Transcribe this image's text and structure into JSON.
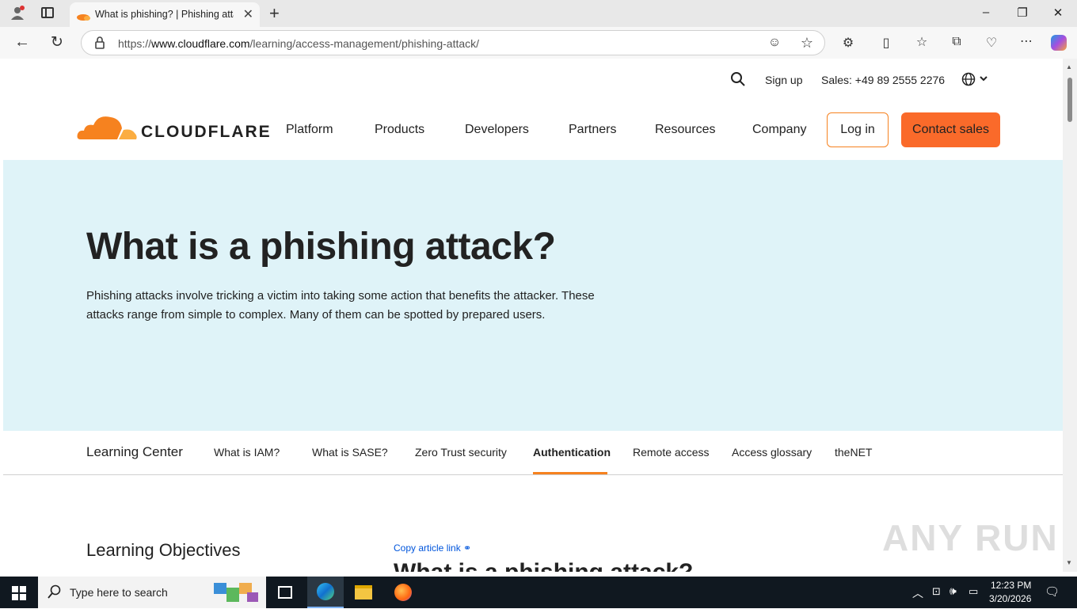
{
  "browser": {
    "tab_title": "What is phishing? | Phishing attac",
    "url_prefix": "https://",
    "url_host": "www.cloudflare.com",
    "url_path": "/learning/access-management/phishing-attack/"
  },
  "utility_nav": {
    "sign_up": "Sign up",
    "sales": "Sales: +49 89 2555 2276"
  },
  "brand": {
    "logo_text": "CLOUDFLARE",
    "orange": "#f6821f",
    "light_orange": "#fbad41"
  },
  "main_nav": {
    "items": [
      "Platform",
      "Products",
      "Developers",
      "Partners",
      "Resources",
      "Company"
    ],
    "login": "Log in",
    "contact": "Contact sales"
  },
  "hero": {
    "title": "What is a phishing attack?",
    "description": "Phishing attacks involve tricking a victim into taking some action that benefits the attacker. These attacks range from simple to complex. Many of them can be spotted by prepared users."
  },
  "sub_nav": {
    "home": "Learning Center",
    "items": [
      "What is IAM?",
      "What is SASE?",
      "Zero Trust security",
      "Authentication",
      "Remote access",
      "Access glossary",
      "theNET"
    ],
    "active": "Authentication"
  },
  "content": {
    "objectives_heading": "Learning Objectives",
    "copy_link": "Copy article link",
    "article_title": "What is a phishing attack?"
  },
  "watermark": "ANY RUN",
  "taskbar": {
    "search_placeholder": "Type here to search",
    "time": "12:23 PM",
    "date": "3/20/2026"
  }
}
